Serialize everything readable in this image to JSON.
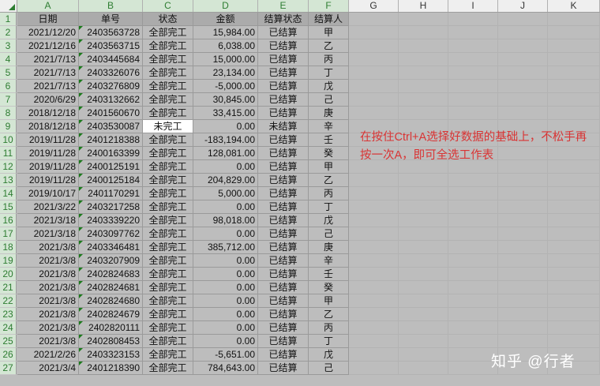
{
  "columns": [
    "A",
    "B",
    "C",
    "D",
    "E",
    "F",
    "G",
    "H",
    "I",
    "J",
    "K"
  ],
  "header_row": [
    "日期",
    "单号",
    "状态",
    "金额",
    "结算状态",
    "结算人"
  ],
  "rows": [
    [
      "2021/12/20",
      "2403563728",
      "全部完工",
      "15,984.00",
      "已结算",
      "甲"
    ],
    [
      "2021/12/16",
      "2403563715",
      "全部完工",
      "6,038.00",
      "已结算",
      "乙"
    ],
    [
      "2021/7/13",
      "2403445684",
      "全部完工",
      "15,000.00",
      "已结算",
      "丙"
    ],
    [
      "2021/7/13",
      "2403326076",
      "全部完工",
      "23,134.00",
      "已结算",
      "丁"
    ],
    [
      "2021/7/13",
      "2403276809",
      "全部完工",
      "-5,000.00",
      "已结算",
      "戊"
    ],
    [
      "2020/6/29",
      "2403132662",
      "全部完工",
      "30,845.00",
      "已结算",
      "己"
    ],
    [
      "2018/12/18",
      "2401560670",
      "全部完工",
      "33,415.00",
      "已结算",
      "庚"
    ],
    [
      "2018/12/18",
      "2403530087",
      "未完工",
      "0.00",
      "未结算",
      "辛"
    ],
    [
      "2019/11/28",
      "2401218388",
      "全部完工",
      "-183,194.00",
      "已结算",
      "壬"
    ],
    [
      "2019/11/28",
      "2400163399",
      "全部完工",
      "128,081.00",
      "已结算",
      "癸"
    ],
    [
      "2019/11/28",
      "2400125191",
      "全部完工",
      "0.00",
      "已结算",
      "甲"
    ],
    [
      "2019/11/28",
      "2400125184",
      "全部完工",
      "204,829.00",
      "已结算",
      "乙"
    ],
    [
      "2019/10/17",
      "2401170291",
      "全部完工",
      "5,000.00",
      "已结算",
      "丙"
    ],
    [
      "2021/3/22",
      "2403217258",
      "全部完工",
      "0.00",
      "已结算",
      "丁"
    ],
    [
      "2021/3/18",
      "2403339220",
      "全部完工",
      "98,018.00",
      "已结算",
      "戊"
    ],
    [
      "2021/3/18",
      "2403097762",
      "全部完工",
      "0.00",
      "已结算",
      "己"
    ],
    [
      "2021/3/8",
      "2403346481",
      "全部完工",
      "385,712.00",
      "已结算",
      "庚"
    ],
    [
      "2021/3/8",
      "2403207909",
      "全部完工",
      "0.00",
      "已结算",
      "辛"
    ],
    [
      "2021/3/8",
      "2402824683",
      "全部完工",
      "0.00",
      "已结算",
      "壬"
    ],
    [
      "2021/3/8",
      "2402824681",
      "全部完工",
      "0.00",
      "已结算",
      "癸"
    ],
    [
      "2021/3/8",
      "2402824680",
      "全部完工",
      "0.00",
      "已结算",
      "甲"
    ],
    [
      "2021/3/8",
      "2402824679",
      "全部完工",
      "0.00",
      "已结算",
      "乙"
    ],
    [
      "2021/3/8",
      "2402820111",
      "全部完工",
      "0.00",
      "已结算",
      "丙"
    ],
    [
      "2021/3/8",
      "2402808453",
      "全部完工",
      "0.00",
      "已结算",
      "丁"
    ],
    [
      "2021/2/26",
      "2403323153",
      "全部完工",
      "-5,651.00",
      "已结算",
      "戊"
    ],
    [
      "2021/3/4",
      "2401218390",
      "全部完工",
      "784,643.00",
      "已结算",
      "己"
    ]
  ],
  "annotation": "在按住Ctrl+A选择好数据的基础上，不松手再按一次A，即可全选工作表",
  "watermark": "知乎 @行者",
  "colors": {
    "selected_fill": "#bdbdbd",
    "header_fill": "#ababab",
    "annotation": "#d93434",
    "row_header_green": "#2e7d32"
  }
}
